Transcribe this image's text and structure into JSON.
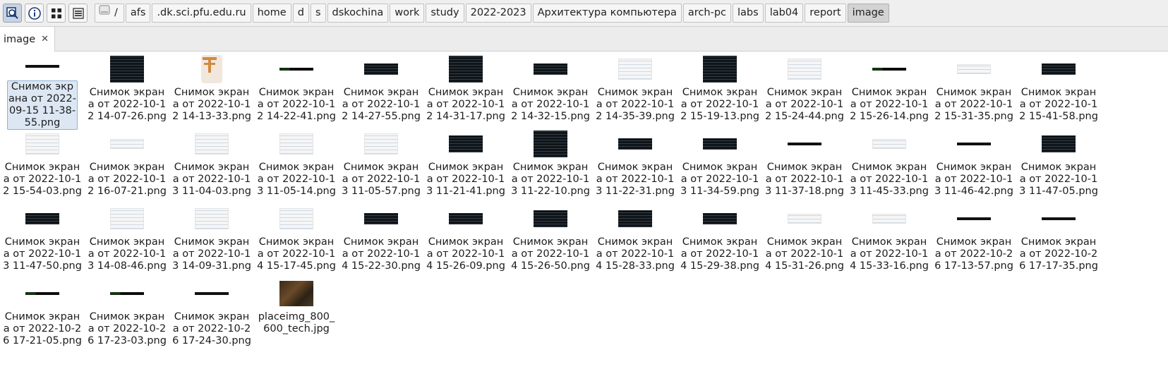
{
  "toolbar": {
    "buttons": [
      {
        "name": "search-location-icon",
        "active": true
      },
      {
        "name": "info-icon",
        "active": false
      },
      {
        "name": "icon-view-icon",
        "active": false
      },
      {
        "name": "list-view-icon",
        "active": false
      }
    ]
  },
  "breadcrumb": [
    "/",
    "afs",
    ".dk.sci.pfu.edu.ru",
    "home",
    "d",
    "s",
    "dskochina",
    "work",
    "study",
    "2022-2023",
    "Архитектура компьютера",
    "arch-pc",
    "labs",
    "lab04",
    "report",
    "image"
  ],
  "tab": {
    "label": "image",
    "close": "✕"
  },
  "files": [
    {
      "name": "Снимок экрана от 2022-09-15 11-38-55.png",
      "thumb": "line",
      "selected": true
    },
    {
      "name": "Снимок экрана от 2022-10-12 14-07-26.png",
      "thumb": "dark-tall"
    },
    {
      "name": "Снимок экрана от 2022-10-12 14-13-33.png",
      "thumb": "logo"
    },
    {
      "name": "Снимок экрана от 2022-10-12 14-22-41.png",
      "thumb": "line-green"
    },
    {
      "name": "Снимок экрана от 2022-10-12 14-27-55.png",
      "thumb": "dark-short"
    },
    {
      "name": "Снимок экрана от 2022-10-12 14-31-17.png",
      "thumb": "dark-tall"
    },
    {
      "name": "Снимок экрана от 2022-10-12 14-32-15.png",
      "thumb": "dark-short"
    },
    {
      "name": "Снимок экрана от 2022-10-12 14-35-39.png",
      "thumb": "light"
    },
    {
      "name": "Снимок экрана от 2022-10-12 15-19-13.png",
      "thumb": "dark-tall"
    },
    {
      "name": "Снимок экрана от 2022-10-12 15-24-44.png",
      "thumb": "light"
    },
    {
      "name": "Снимок экрана от 2022-10-12 15-26-14.png",
      "thumb": "line-green"
    },
    {
      "name": "Снимок экрана от 2022-10-12 15-31-35.png",
      "thumb": "light-small"
    },
    {
      "name": "Снимок экрана от 2022-10-12 15-41-58.png",
      "thumb": "dark-short"
    },
    {
      "name": "Снимок экрана от 2022-10-12 15-54-03.png",
      "thumb": "light"
    },
    {
      "name": "Снимок экрана от 2022-10-12 16-07-21.png",
      "thumb": "light-small"
    },
    {
      "name": "Снимок экрана от 2022-10-13 11-04-03.png",
      "thumb": "light"
    },
    {
      "name": "Снимок экрана от 2022-10-13 11-05-14.png",
      "thumb": "light"
    },
    {
      "name": "Снимок экрана от 2022-10-13 11-05-57.png",
      "thumb": "light"
    },
    {
      "name": "Снимок экрана от 2022-10-13 11-21-41.png",
      "thumb": "dark-mid"
    },
    {
      "name": "Снимок экрана от 2022-10-13 11-22-10.png",
      "thumb": "dark-tall"
    },
    {
      "name": "Снимок экрана от 2022-10-13 11-22-31.png",
      "thumb": "dark-short"
    },
    {
      "name": "Снимок экрана от 2022-10-13 11-34-59.png",
      "thumb": "dark-short"
    },
    {
      "name": "Снимок экрана от 2022-10-13 11-37-18.png",
      "thumb": "line"
    },
    {
      "name": "Снимок экрана от 2022-10-13 11-45-33.png",
      "thumb": "light-small"
    },
    {
      "name": "Снимок экрана от 2022-10-13 11-46-42.png",
      "thumb": "line"
    },
    {
      "name": "Снимок экрана от 2022-10-13 11-47-05.png",
      "thumb": "dark-mid"
    },
    {
      "name": "Снимок экрана от 2022-10-13 11-47-50.png",
      "thumb": "dark-short"
    },
    {
      "name": "Снимок экрана от 2022-10-13 14-08-46.png",
      "thumb": "light"
    },
    {
      "name": "Снимок экрана от 2022-10-13 14-09-31.png",
      "thumb": "light"
    },
    {
      "name": "Снимок экрана от 2022-10-14 15-17-45.png",
      "thumb": "light"
    },
    {
      "name": "Снимок экрана от 2022-10-14 15-22-30.png",
      "thumb": "dark-short"
    },
    {
      "name": "Снимок экрана от 2022-10-14 15-26-09.png",
      "thumb": "dark-short"
    },
    {
      "name": "Снимок экрана от 2022-10-14 15-26-50.png",
      "thumb": "dark-mid"
    },
    {
      "name": "Снимок экрана от 2022-10-14 15-28-33.png",
      "thumb": "dark-mid"
    },
    {
      "name": "Снимок экрана от 2022-10-14 15-29-38.png",
      "thumb": "dark-short"
    },
    {
      "name": "Снимок экрана от 2022-10-14 15-31-26.png",
      "thumb": "light-small"
    },
    {
      "name": "Снимок экрана от 2022-10-14 15-33-16.png",
      "thumb": "light-small"
    },
    {
      "name": "Снимок экрана от 2022-10-26 17-13-57.png",
      "thumb": "line"
    },
    {
      "name": "Снимок экрана от 2022-10-26 17-17-35.png",
      "thumb": "line"
    },
    {
      "name": "Снимок экрана от 2022-10-26 17-21-05.png",
      "thumb": "line-green"
    },
    {
      "name": "Снимок экрана от 2022-10-26 17-23-03.png",
      "thumb": "line-green"
    },
    {
      "name": "Снимок экрана от 2022-10-26 17-24-30.png",
      "thumb": "line"
    },
    {
      "name": "placeimg_800_600_tech.jpg",
      "thumb": "photo"
    }
  ]
}
